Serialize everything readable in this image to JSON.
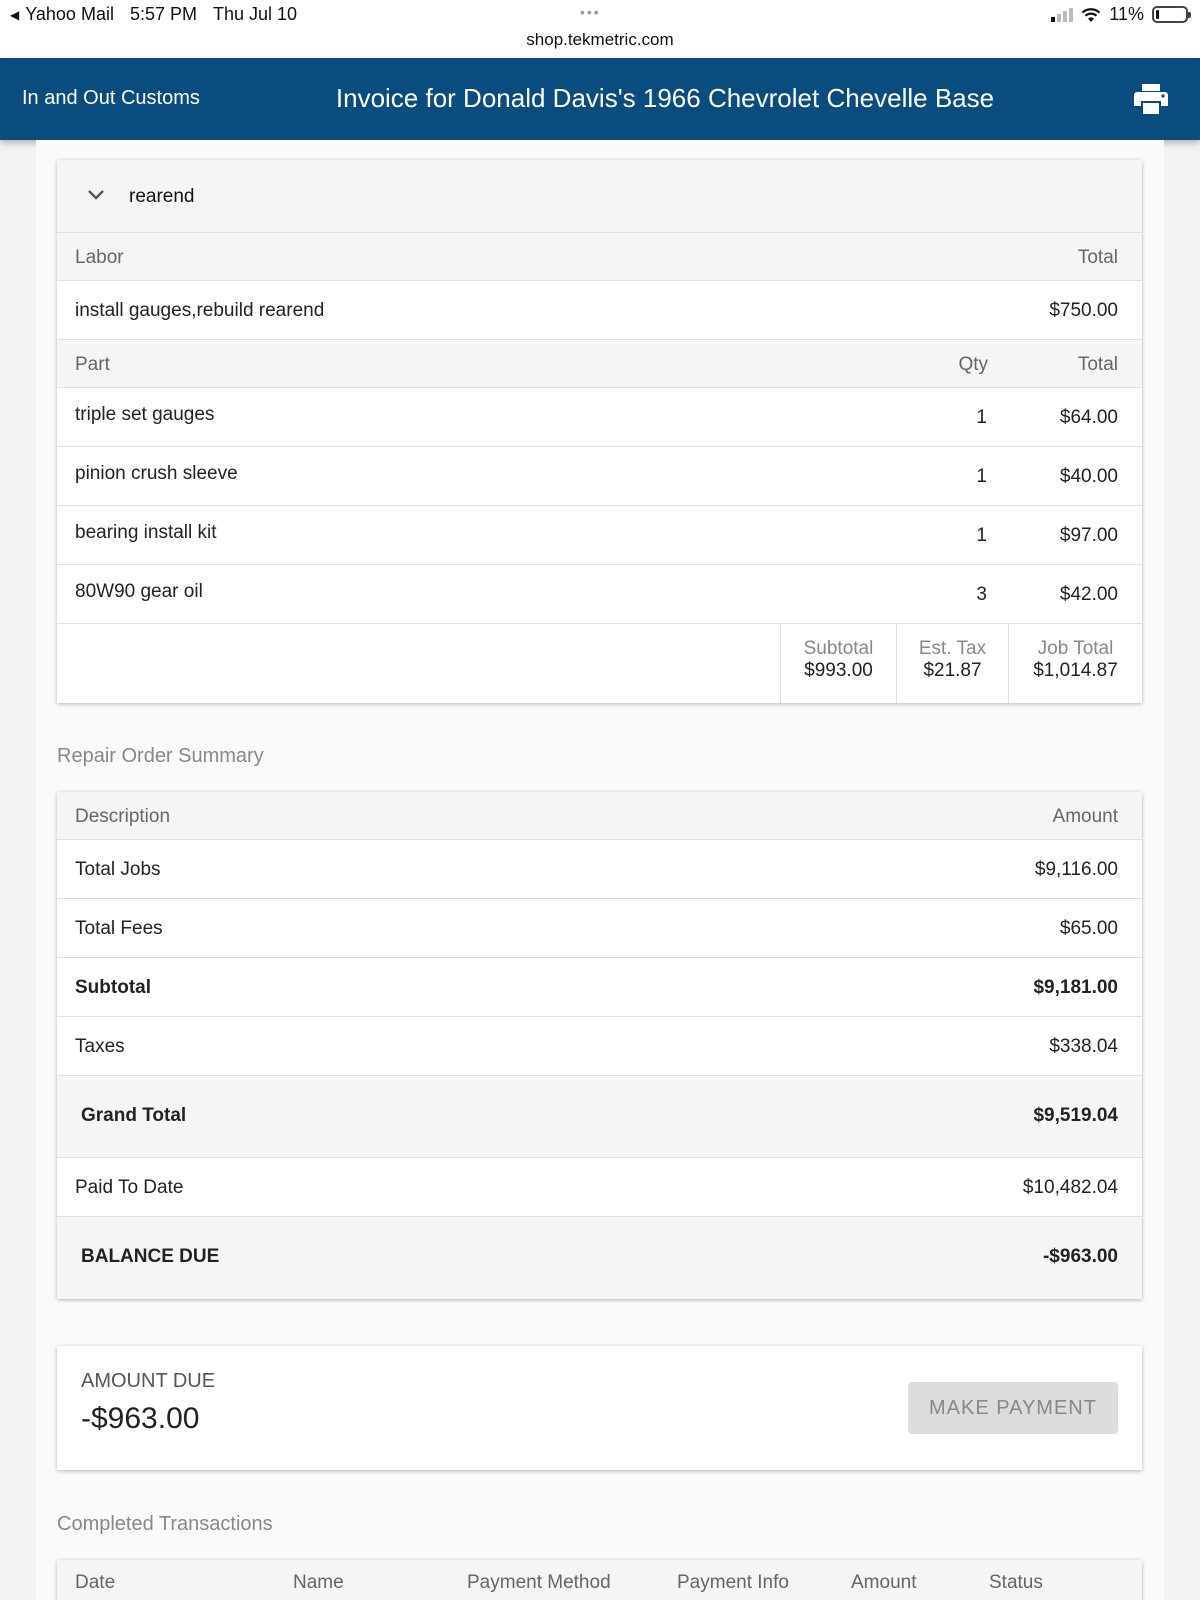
{
  "status_bar": {
    "app": "Yahoo Mail",
    "time": "5:57 PM",
    "date": "Thu Jul 10",
    "dots": "•••",
    "url": "shop.tekmetric.com",
    "battery": "11%"
  },
  "header": {
    "shop_name": "In and Out Customs",
    "title": "Invoice for Donald Davis's 1966 Chevrolet Chevelle Base",
    "print_icon": "printer-icon"
  },
  "job": {
    "name": "rearend",
    "labor_header": {
      "label": "Labor",
      "total": "Total"
    },
    "labor_items": [
      {
        "description": "install gauges,rebuild rearend",
        "total": "$750.00"
      }
    ],
    "part_header": {
      "label": "Part",
      "qty": "Qty",
      "total": "Total"
    },
    "parts": [
      {
        "name": "triple set gauges",
        "qty": "1",
        "total": "$64.00"
      },
      {
        "name": "pinion crush sleeve",
        "qty": "1",
        "total": "$40.00"
      },
      {
        "name": "bearing install kit",
        "qty": "1",
        "total": "$97.00"
      },
      {
        "name": "80W90 gear oil",
        "qty": "3",
        "total": "$42.00"
      }
    ],
    "subtotal_label": "Subtotal",
    "subtotal": "$993.00",
    "tax_label": "Est. Tax",
    "tax": "$21.87",
    "job_total_label": "Job Total",
    "job_total": "$1,014.87"
  },
  "summary": {
    "section_title": "Repair Order Summary",
    "header": {
      "description": "Description",
      "amount": "Amount"
    },
    "rows": [
      {
        "label": "Total Jobs",
        "amount": "$9,116.00"
      },
      {
        "label": "Total Fees",
        "amount": "$65.00"
      },
      {
        "label": "Subtotal",
        "amount": "$9,181.00"
      },
      {
        "label": "Taxes",
        "amount": "$338.04"
      },
      {
        "label": "Grand Total",
        "amount": "$9,519.04"
      },
      {
        "label": "Paid To Date",
        "amount": "$10,482.04"
      },
      {
        "label": "BALANCE DUE",
        "amount": "-$963.00"
      }
    ]
  },
  "amount_due": {
    "label": "AMOUNT DUE",
    "value": "-$963.00",
    "button": "MAKE PAYMENT"
  },
  "transactions": {
    "section_title": "Completed Transactions",
    "columns": [
      "Date",
      "Name",
      "Payment Method",
      "Payment Info",
      "Amount",
      "Status"
    ]
  }
}
